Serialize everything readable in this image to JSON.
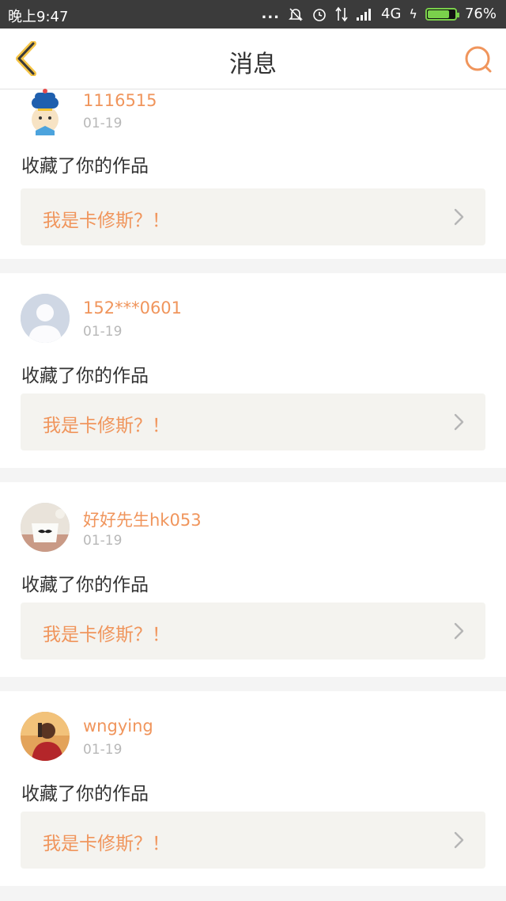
{
  "status_bar": {
    "time": "晚上9:47",
    "dots": "...",
    "network": "4G",
    "battery": "76%",
    "battery_level": 0.76
  },
  "header": {
    "title": "消息",
    "back_icon": "chevron-left-icon",
    "search_icon": "search-icon"
  },
  "colors": {
    "accent": "#f0955c",
    "back_icon": "#f5c445",
    "card_bg": "#ffffff",
    "work_bg": "#f4f3ef",
    "page_bg": "#f4f4f4"
  },
  "messages": [
    {
      "username": "1116515",
      "date": "01-19",
      "action": "收藏了你的作品",
      "work_title": "我是卡修斯？！",
      "avatar": "cartoon-boy-avatar"
    },
    {
      "username": "152***0601",
      "date": "01-19",
      "action": "收藏了你的作品",
      "work_title": "我是卡修斯？！",
      "avatar": "default-user-avatar"
    },
    {
      "username": "好好先生hk053",
      "date": "01-19",
      "action": "收藏了你的作品",
      "work_title": "我是卡修斯？！",
      "avatar": "mustache-cup-avatar"
    },
    {
      "username": "wngying",
      "date": "01-19",
      "action": "收藏了你的作品",
      "work_title": "我是卡修斯？！",
      "avatar": "photo-person-avatar"
    }
  ]
}
